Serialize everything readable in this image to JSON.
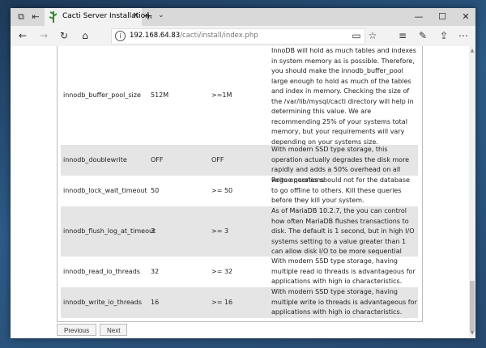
{
  "browser": {
    "tab_title": "Cacti Server Installation,",
    "url_host": "192.168.64.83",
    "url_path": "/cacti/install/index.php"
  },
  "table": {
    "rows": [
      {
        "name": "innodb_buffer_pool_size",
        "current": "512M",
        "recommended": ">=1M",
        "description": "InnoDB will hold as much tables and indexes in system memory as is possible. Therefore, you should make the innodb_buffer_pool large enough to hold as much of the tables and index in memory. Checking the size of the /var/lib/mysql/cacti directory will help in determining this value. We are recommending 25% of your systems total memory, but your requirements will vary depending on your systems size."
      },
      {
        "name": "innodb_doublewrite",
        "current": "OFF",
        "recommended": "OFF",
        "description": "With modern SSD type storage, this operation actually degrades the disk more rapidly and adds a 50% overhead on all write operations."
      },
      {
        "name": "innodb_lock_wait_timeout",
        "current": "50",
        "recommended": ">= 50",
        "description": "Rogue queries should not for the database to go offline to others. Kill these queries before they kill your system."
      },
      {
        "name": "innodb_flush_log_at_timeout",
        "current": "3",
        "recommended": ">= 3",
        "description": "As of MariaDB 10.2.7, the you can control how often MariaDB flushes transactions to disk. The default is 1 second, but in high I/O systems setting to a value greater than 1 can allow disk I/O to be more sequential"
      },
      {
        "name": "innodb_read_io_threads",
        "current": "32",
        "recommended": ">= 32",
        "description": "With modern SSD type storage, having multiple read io threads is advantageous for applications with high io characteristics."
      },
      {
        "name": "innodb_write_io_threads",
        "current": "16",
        "recommended": ">= 16",
        "description": "With modern SSD type storage, having multiple write io threads is advantageous for applications with high io characteristics."
      }
    ]
  },
  "footer": {
    "previous_label": "Previous",
    "next_label": "Next"
  }
}
